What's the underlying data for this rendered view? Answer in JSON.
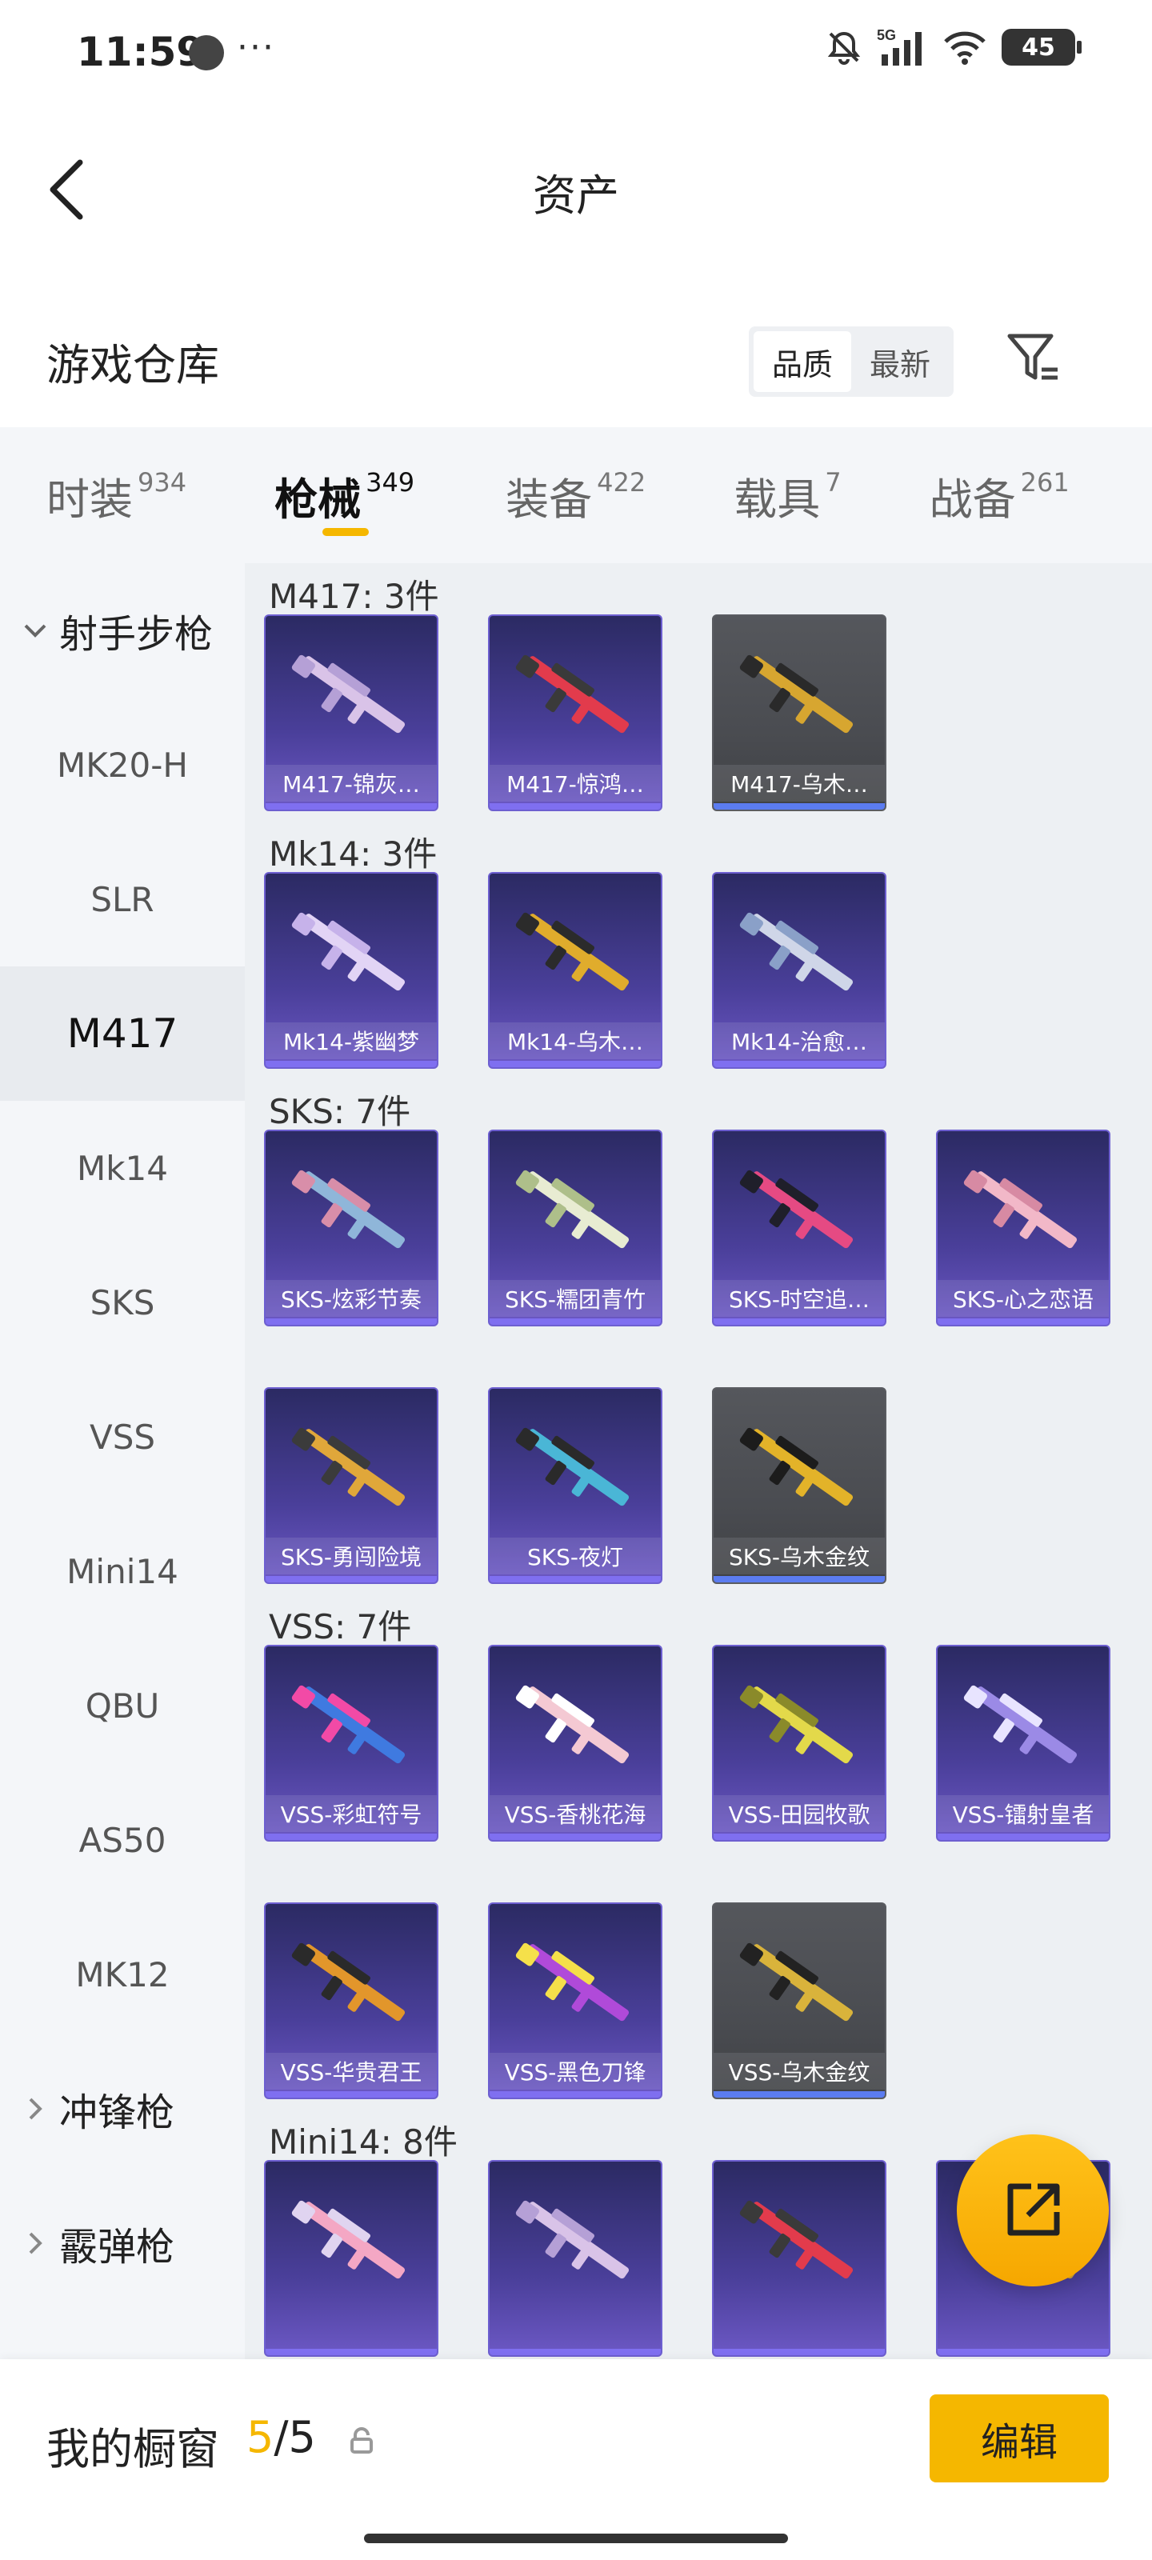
{
  "status_bar": {
    "time": "11:59",
    "more": "···",
    "network": "5G",
    "battery": "45",
    "icons": [
      "clock-icon",
      "mute-bell-icon",
      "signal-icon",
      "wifi-icon",
      "battery-icon"
    ]
  },
  "header": {
    "title": "资产",
    "back_icon": "chevron-left-icon"
  },
  "warehouse": {
    "title": "游戏仓库",
    "sort_options": [
      "品质",
      "最新"
    ],
    "sort_selected": "品质",
    "filter_icon": "filter-icon"
  },
  "tabs": [
    {
      "label": "时装",
      "count": "934"
    },
    {
      "label": "枪械",
      "count": "349",
      "active": true
    },
    {
      "label": "装备",
      "count": "422"
    },
    {
      "label": "载具",
      "count": "7"
    },
    {
      "label": "战备",
      "count": "261"
    }
  ],
  "sidebar": {
    "group_open": "射手步枪",
    "items": [
      "MK20-H",
      "SLR",
      "M417",
      "Mk14",
      "SKS",
      "VSS",
      "Mini14",
      "QBU",
      "AS50",
      "MK12"
    ],
    "selected": "M417",
    "groups_closed": [
      "冲锋枪",
      "霰弹枪"
    ]
  },
  "groups": [
    {
      "title": "M417: 3件",
      "items": [
        {
          "name": "M417-锦灰…",
          "quality": "purple"
        },
        {
          "name": "M417-惊鸿…",
          "quality": "purple"
        },
        {
          "name": "M417-乌木…",
          "quality": "gray"
        }
      ]
    },
    {
      "title": "Mk14: 3件",
      "items": [
        {
          "name": "Mk14-紫幽梦",
          "quality": "purple"
        },
        {
          "name": "Mk14-乌木…",
          "quality": "purple"
        },
        {
          "name": "Mk14-治愈…",
          "quality": "purple"
        }
      ]
    },
    {
      "title": "SKS: 7件",
      "items": [
        {
          "name": "SKS-炫彩节奏",
          "quality": "purple"
        },
        {
          "name": "SKS-糯团青竹",
          "quality": "purple"
        },
        {
          "name": "SKS-时空追…",
          "quality": "purple"
        },
        {
          "name": "SKS-心之恋语",
          "quality": "purple"
        },
        {
          "name": "SKS-勇闯险境",
          "quality": "purple"
        },
        {
          "name": "SKS-夜灯",
          "quality": "purple"
        },
        {
          "name": "SKS-乌木金纹",
          "quality": "gray"
        }
      ]
    },
    {
      "title": "VSS: 7件",
      "items": [
        {
          "name": "VSS-彩虹符号",
          "quality": "purple"
        },
        {
          "name": "VSS-香桃花海",
          "quality": "purple"
        },
        {
          "name": "VSS-田园牧歌",
          "quality": "purple"
        },
        {
          "name": "VSS-镭射皇者",
          "quality": "purple"
        },
        {
          "name": "VSS-华贵君王",
          "quality": "purple"
        },
        {
          "name": "VSS-黑色刀锋",
          "quality": "purple"
        },
        {
          "name": "VSS-乌木金纹",
          "quality": "gray"
        }
      ]
    },
    {
      "title": "Mini14: 8件",
      "items": [
        {
          "name": "",
          "quality": "purple"
        },
        {
          "name": "",
          "quality": "purple"
        },
        {
          "name": "",
          "quality": "purple"
        },
        {
          "name": "",
          "quality": "purple"
        }
      ]
    }
  ],
  "fab": {
    "icon": "share-external-icon"
  },
  "bottom_bar": {
    "label": "我的橱窗",
    "count_current": "5",
    "count_total": "/5",
    "edit_label": "编辑",
    "lock_icon": "lock-icon"
  },
  "colors": {
    "accent": "#f5b700",
    "card_purple": "#4a3f9a",
    "card_gray": "#4a4c51",
    "sidebar_bg": "#f4f6f9",
    "content_bg": "#edf0f3"
  }
}
